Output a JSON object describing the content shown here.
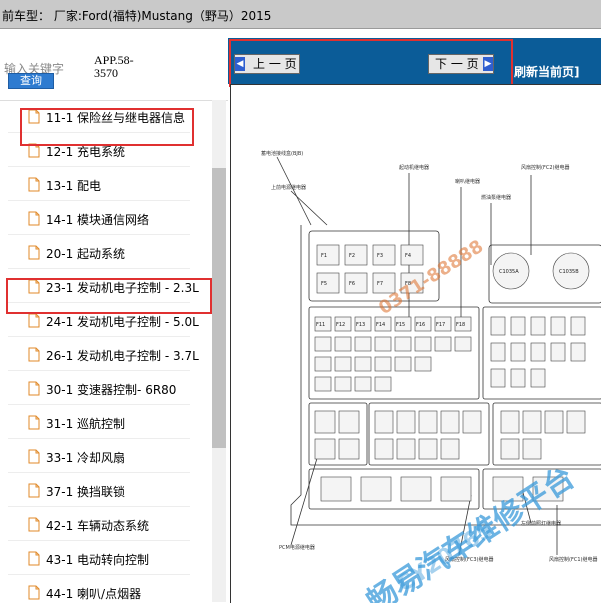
{
  "window": {
    "title": "前车型：  厂家:Ford(福特)Mustang（野马）2015"
  },
  "search": {
    "placeholder": "输入关键字",
    "query_button": "查询",
    "app_code_line1": "APP.58-",
    "app_code_line2": "3570"
  },
  "tree": {
    "items": [
      {
        "label": "11-1 保险丝与继电器信息"
      },
      {
        "label": "12-1 充电系统"
      },
      {
        "label": "13-1 配电"
      },
      {
        "label": "14-1 模块通信网络"
      },
      {
        "label": "20-1 起动系统"
      },
      {
        "label": "23-1 发动机电子控制 - 2.3L"
      },
      {
        "label": "24-1 发动机电子控制 - 5.0L"
      },
      {
        "label": "26-1 发动机电子控制 - 3.7L"
      },
      {
        "label": "30-1 变速器控制- 6R80"
      },
      {
        "label": "31-1 巡航控制"
      },
      {
        "label": "33-1 冷却风扇"
      },
      {
        "label": "37-1 换挡联锁"
      },
      {
        "label": "42-1 车辆动态系统"
      },
      {
        "label": "43-1 电动转向控制"
      },
      {
        "label": "44-1 喇叭/点烟器"
      }
    ]
  },
  "toolbar": {
    "prev_label": "上 一 页",
    "next_label": "下 一 页",
    "refresh_label": "刷新当前页]"
  },
  "diagram": {
    "labels": {
      "battery": "蓄电池接线盒(BJB)",
      "top_relay": "上前电源继电器",
      "starter_relay": "起动机继电器",
      "horn_relay": "喇叭继电器",
      "pump_relay": "燃油泵继电器",
      "fan_ctrl": "风扇控制(FC2)继电器",
      "pcm_relay": "PCM电源继电器",
      "wiper_relay": "左侧前照灯继电器",
      "fan_low": "风扇控制(FC3)继电器",
      "fan_low2": "风扇控制(FC1)继电器"
    },
    "relays": [
      "C1035A",
      "C1035B"
    ],
    "fuses_top": [
      "F1",
      "F2",
      "F3",
      "F4",
      "F5",
      "F6",
      "F7",
      "F8"
    ],
    "fuses_mid": [
      "F11",
      "F12",
      "F13",
      "F14",
      "F15",
      "F16",
      "F17",
      "F18"
    ]
  },
  "watermarks": {
    "site_cn": "畅易汽车维修平台",
    "site_code": "CY20765",
    "phone": "0371-88888"
  },
  "colors": {
    "accent": "#0b5c98",
    "highlight": "#e03030",
    "watermark": "#3a9ad9"
  }
}
